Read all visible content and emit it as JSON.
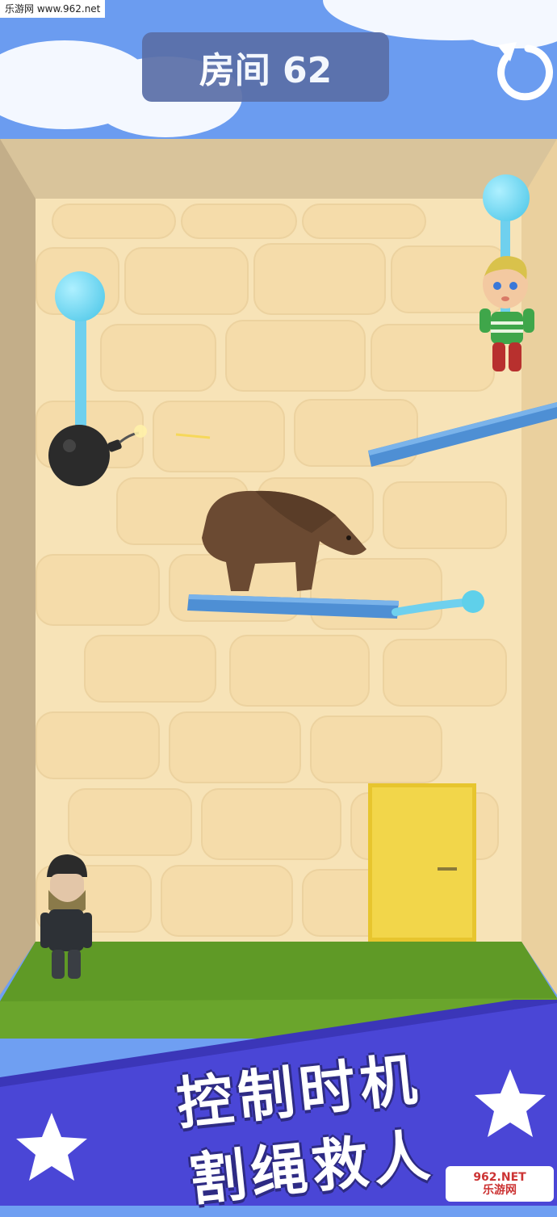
{
  "watermark_top": "乐游网 www.962.net",
  "hud": {
    "room_label": "房间 62",
    "restart_icon": "restart-arrow-icon"
  },
  "caption": {
    "line1": "控制时机",
    "line2": "割绳救人"
  },
  "watermark_bottom": {
    "line1": "962.NET",
    "line2": "乐游网"
  },
  "colors": {
    "sky": "#6b9cf0",
    "wall": "#f7e3b7",
    "rope": "#6fd0ee",
    "pin_knob": "#5fd0ea",
    "platform": "#4e8fd4",
    "floor": "#65a72b",
    "banner": "#4a46d6",
    "door": "#f2d64a"
  },
  "scene": {
    "characters": [
      "boy-hanging",
      "bear",
      "masked-thief"
    ],
    "objects": [
      "bomb",
      "left-pin-rope",
      "right-pin-rope",
      "platform-pin",
      "sloped-platform",
      "bear-platform",
      "exit-door"
    ]
  }
}
